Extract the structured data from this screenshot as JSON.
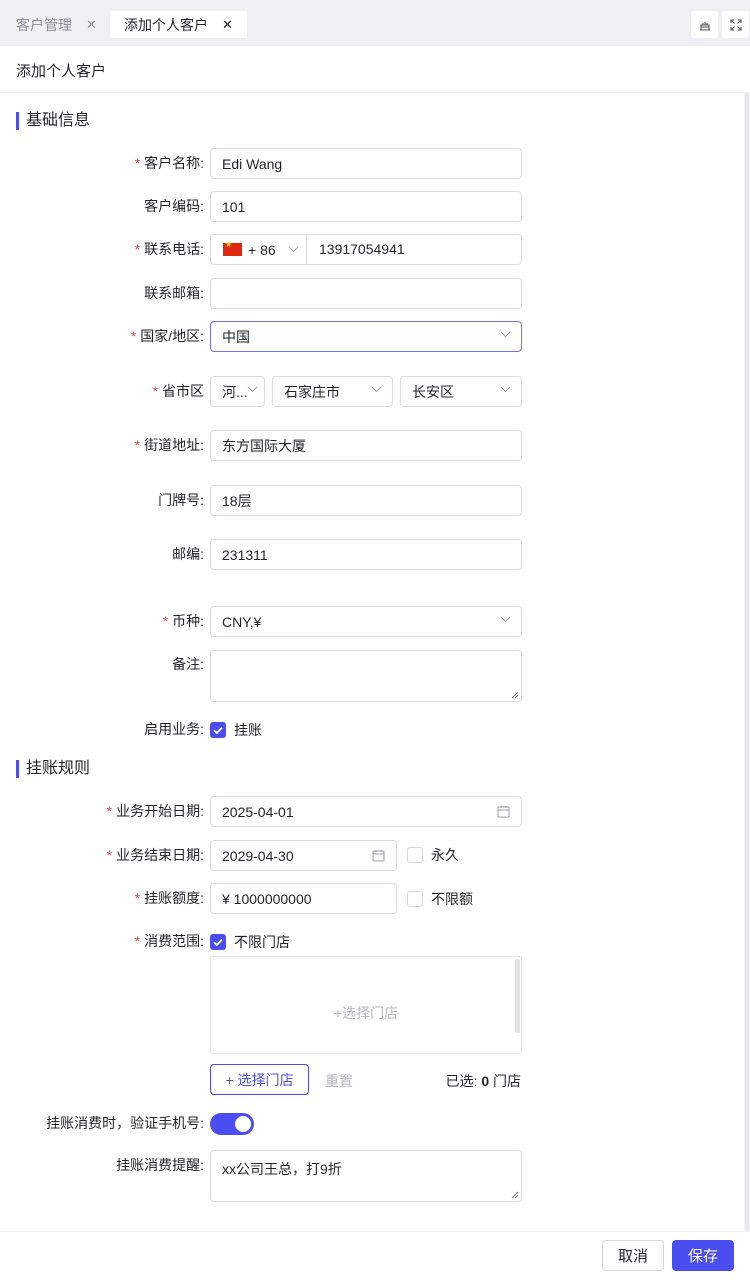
{
  "tabs": [
    {
      "label": "客户管理",
      "close": "✕"
    },
    {
      "label": "添加个人客户",
      "close": "✕"
    }
  ],
  "page": {
    "title": "添加个人客户"
  },
  "sections": {
    "basic": "基础信息",
    "credit": "挂账规则"
  },
  "required_mark": "*",
  "basic": {
    "name": {
      "label": "客户名称:",
      "value": "Edi Wang"
    },
    "code": {
      "label": "客户编码:",
      "value": "101"
    },
    "phone": {
      "label": "联系电话:",
      "country_code": "+ 86",
      "value": "13917054941",
      "flag": "china-flag-icon"
    },
    "email": {
      "label": "联系邮箱:",
      "value": ""
    },
    "country": {
      "label": "国家/地区:",
      "value": "中国"
    },
    "region": {
      "label": "省市区",
      "province": "河...",
      "city": "石家庄市",
      "district": "长安区"
    },
    "street": {
      "label": "街道地址:",
      "value": "东方国际大厦"
    },
    "door": {
      "label": "门牌号:",
      "value": "18层"
    },
    "zip": {
      "label": "邮编:",
      "value": "231311"
    },
    "currency": {
      "label": "币种:",
      "value": "CNY,¥"
    },
    "remark": {
      "label": "备注:",
      "value": ""
    },
    "business": {
      "label": "启用业务:",
      "option": "挂账",
      "checked": true
    }
  },
  "credit": {
    "start": {
      "label": "业务开始日期:",
      "value": "2025-04-01"
    },
    "end": {
      "label": "业务结束日期:",
      "value": "2029-04-30",
      "forever": "永久",
      "forever_checked": false
    },
    "amount": {
      "label": "挂账额度:",
      "value": "¥ 1000000000",
      "unlimited": "不限额",
      "unlimited_checked": false
    },
    "scope": {
      "label": "消费范围:",
      "option": "不限门店",
      "checked": true,
      "placeholder": "+选择门店"
    },
    "select_store_button": "+ 选择门店",
    "reset_button": "重置",
    "selected": {
      "prefix": "已选: ",
      "count": "0",
      "suffix": " 门店"
    },
    "verify_phone": {
      "label": "挂账消费时，验证手机号:",
      "on": true
    },
    "reminder": {
      "label": "挂账消费提醒:",
      "value": "xx公司王总，打9折"
    }
  },
  "footer": {
    "cancel": "取消",
    "save": "保存"
  },
  "colors": {
    "primary": "#4a4ef0",
    "required": "#f0454a",
    "border": "#dadde3"
  }
}
